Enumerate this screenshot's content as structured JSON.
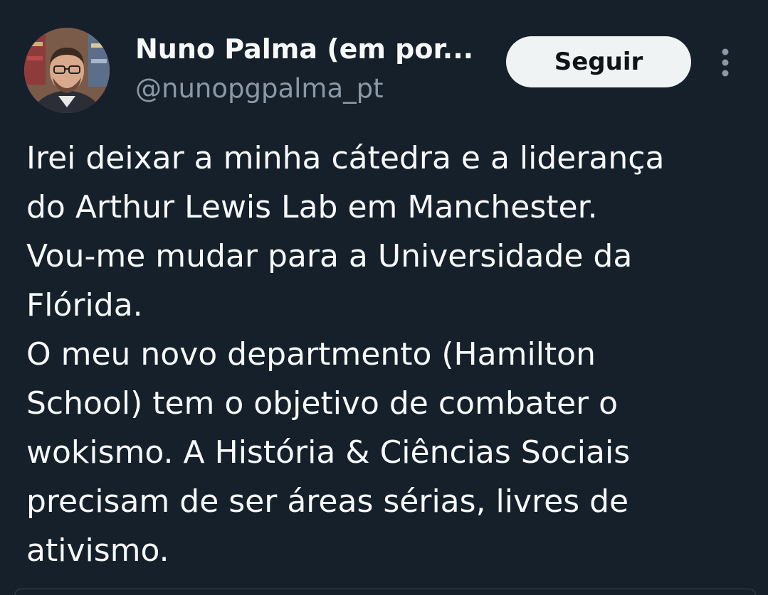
{
  "author": {
    "display_name": "Nuno Palma (em por...",
    "handle": "@nunopgpalma_pt",
    "avatar_icon": "profile-photo"
  },
  "actions": {
    "follow_label": "Seguir",
    "more_icon": "vertical-ellipsis-icon"
  },
  "tweet": {
    "lines": [
      "Irei deixar a minha cátedra e a liderança",
      "do Arthur Lewis Lab em Manchester.",
      "Vou-me mudar para a Universidade da",
      "Flórida.",
      "O meu novo departmento (Hamilton",
      "School) tem o objetivo de combater o",
      "wokismo. A História & Ciências Sociais",
      "precisam de ser áreas sérias, livres de",
      "ativismo."
    ]
  },
  "colors": {
    "background": "#15202b",
    "text_primary": "#f7f9f9",
    "text_secondary": "#8b98a5",
    "button_bg": "#eff3f4",
    "button_text": "#0f1419"
  }
}
